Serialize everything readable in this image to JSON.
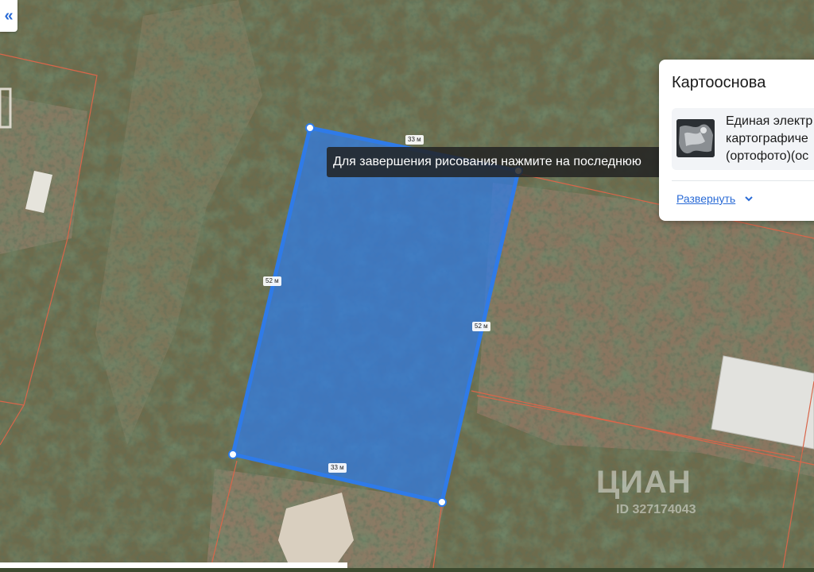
{
  "sidebar": {
    "collapse_icon": "double-chevron-left-icon",
    "collapse_glyph": "«"
  },
  "map": {
    "base": "satellite-orthophoto",
    "colors": {
      "parcel_border": "#d9664a",
      "polygon_fill": "#2f7be8",
      "polygon_stroke": "#2f7be8"
    },
    "segment_labels": {
      "top": "33 м",
      "left": "52 м",
      "right": "52 м",
      "bottom": "33 м"
    },
    "drawing_hint": "Для завершения рисования нажмите на последнюю"
  },
  "basemap_panel": {
    "title": "Картооснова",
    "layer_line1": "Единая электр",
    "layer_line2": "картографиче",
    "layer_line3": "(ортофото)(ос",
    "expand_label": "Развернуть",
    "expand_icon": "chevron-down-icon"
  },
  "watermark": {
    "logo": "ЦИАН",
    "id_text": "ID 327174043"
  }
}
